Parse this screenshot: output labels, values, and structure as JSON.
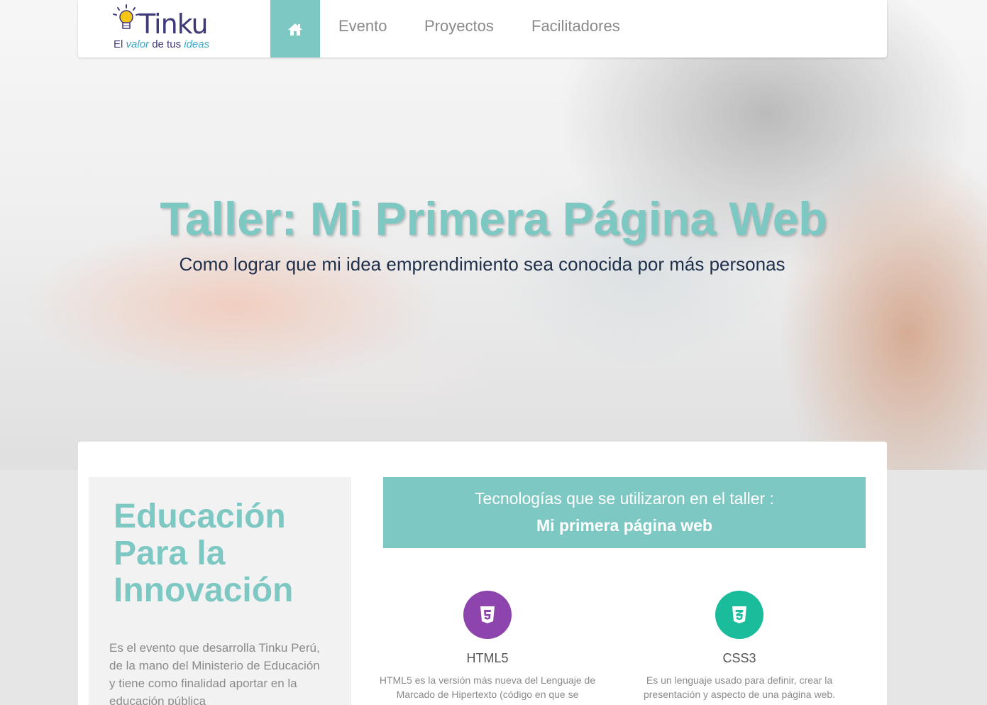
{
  "brand": {
    "name": "Tinku",
    "tagline_dark_1": "El",
    "tagline_light_1": "valor",
    "tagline_dark_2": "de tus",
    "tagline_light_2": "ideas"
  },
  "nav": {
    "home_icon": "home-icon",
    "items": [
      {
        "label": "Evento"
      },
      {
        "label": "Proyectos"
      },
      {
        "label": "Facilitadores"
      }
    ]
  },
  "hero": {
    "title": "Taller: Mi Primera Página Web",
    "subtitle": "Como lograr que mi idea emprendimiento sea conocida por más personas"
  },
  "intro": {
    "heading": "Educación Para la Innovación",
    "text": "Es el evento que desarrolla Tinku Perú, de la mano del Ministerio de Educación y tiene como finalidad aportar en la educación pública"
  },
  "technologies": {
    "heading": "Tecnologías que se utilizaron en el taller :",
    "subheading": "Mi primera página web",
    "items": [
      {
        "icon": "html5-icon",
        "title": "HTML5",
        "description": "HTML5 es la versión más nueva del Lenguaje de Marcado de Hipertexto (código en que se",
        "color": "#8e44ad"
      },
      {
        "icon": "css3-icon",
        "title": "CSS3",
        "description": "Es un lenguaje usado para definir, crear la presentación y aspecto de una página web.",
        "color": "#1abc9c"
      }
    ]
  },
  "colors": {
    "accent": "#7ec8c4",
    "brand_dark": "#3e3a7a",
    "brand_light": "#38a9c8",
    "subtitle": "#1f2f4a"
  }
}
